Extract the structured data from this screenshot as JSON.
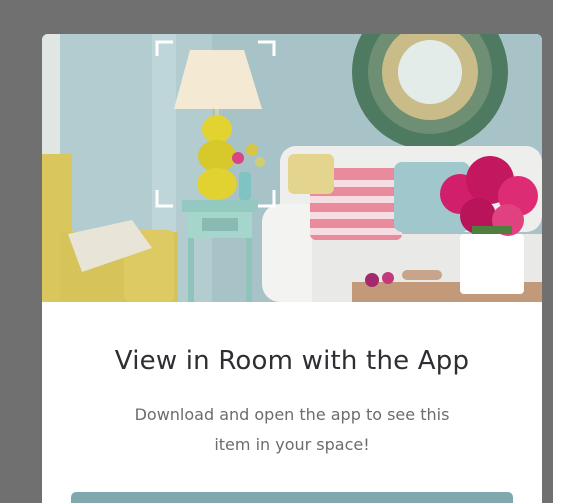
{
  "modal": {
    "title": "View in Room with the App",
    "subtitle": "Download and open the app to see this item in your space!",
    "cta_label": ""
  },
  "colors": {
    "backdrop": "#707071",
    "button": "#7fa9ae",
    "title_text": "#2f2e33",
    "subtitle_text": "#6c6b6f"
  },
  "icons": {
    "scan_frame": "scan-frame-icon"
  }
}
